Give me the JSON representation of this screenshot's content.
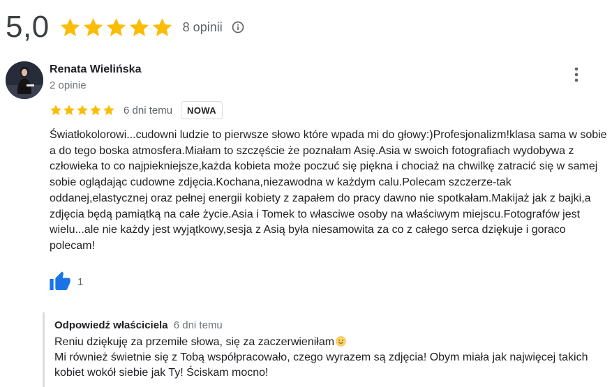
{
  "summary": {
    "score": "5,0",
    "stars": 5,
    "review_count": "8 opinii",
    "icons": {
      "star": "star-icon",
      "info": "info-icon"
    },
    "star_color": "#fbbc04"
  },
  "review": {
    "author": "Renata Wielińska",
    "author_meta": "2 opinie",
    "rating": 5,
    "date": "6 dni temu",
    "badge": "NOWA",
    "text": "Światłokolorowi...cudowni ludzie to pierwsze słowo które wpada mi do głowy:)Profesjonalizm!klasa sama w sobie a do tego boska atmosfera.Miałam to szczęście że poznałam Asię.Asia w swoich fotografiach wydobywa z człowieka to co najpiekniejsze,każda kobieta może poczuć się piękna i chociaż na chwilkę zatracić się w samej sobie oglądając cudowne zdjęcia.Kochana,niezawodna w każdym calu.Polecam szczerze-tak oddanej,elastycznej oraz pełnej energii kobiety z zapałem do pracy dawno nie spotkałam.Makijaż jak z bajki,a zdjęcia będą pamiątką na całe życie.Asia i Tomek to własciwe osoby na właściwym miejscu.Fotografów jest wielu...ale nie każdy jest wyjątkowy,sesja z Asią była niesamowita za co z całego serca dziękuje i goraco polecam!",
    "likes": "1",
    "icons": {
      "menu": "more-vert-icon",
      "like": "thumb-up-icon"
    },
    "like_color": "#1a73e8"
  },
  "owner_reply": {
    "label": "Odpowiedź właściciela",
    "date": "6 dni temu",
    "line1": "Reniu dziękuję za przemiłe słowa, się za zaczerwieniłam",
    "line1_emoji": "slightly-smiling-face",
    "line2": "Mi również świetnie się z Tobą współpracowało, czego wyrazem są zdjęcia! Obym miała jak najwięcej takich kobiet wokół siebie jak Ty! Ściskam mocno!"
  }
}
